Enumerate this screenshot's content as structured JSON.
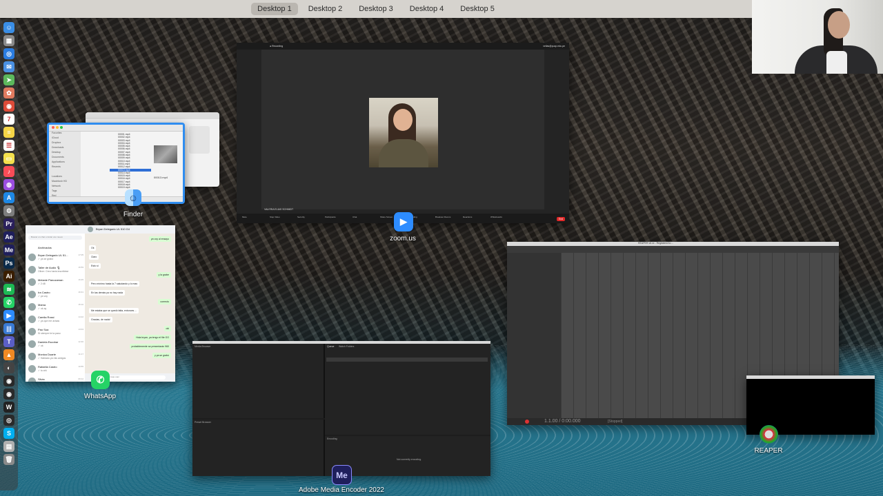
{
  "spaces": [
    "Desktop 1",
    "Desktop 2",
    "Desktop 3",
    "Desktop 4",
    "Desktop 5"
  ],
  "active_space": "Desktop 1",
  "dock_icons": [
    {
      "name": "finder-dock-icon",
      "color": "#3a8ee6",
      "glyph": "☺"
    },
    {
      "name": "launchpad-dock-icon",
      "color": "#8a8a8a",
      "glyph": "▦"
    },
    {
      "name": "safari-dock-icon",
      "color": "#2a7ce0",
      "glyph": "◎"
    },
    {
      "name": "mail-dock-icon",
      "color": "#4a90e2",
      "glyph": "✉"
    },
    {
      "name": "maps-dock-icon",
      "color": "#5cb85c",
      "glyph": "➤"
    },
    {
      "name": "photos-dock-icon",
      "color": "#e07a5f",
      "glyph": "✿"
    },
    {
      "name": "chrome-dock-icon",
      "color": "#dd4b39",
      "glyph": "◉"
    },
    {
      "name": "calendar-dock-icon",
      "color": "#ffffff",
      "glyph": "7"
    },
    {
      "name": "notes-dock-icon",
      "color": "#f5d547",
      "glyph": "≡"
    },
    {
      "name": "reminders-dock-icon",
      "color": "#ffffff",
      "glyph": "☰"
    },
    {
      "name": "stickies-dock-icon",
      "color": "#f4e04d",
      "glyph": "▭"
    },
    {
      "name": "music-dock-icon",
      "color": "#f94c57",
      "glyph": "♪"
    },
    {
      "name": "podcasts-dock-icon",
      "color": "#9b4de0",
      "glyph": "◍"
    },
    {
      "name": "appstore-dock-icon",
      "color": "#1e88e5",
      "glyph": "A"
    },
    {
      "name": "settings-dock-icon",
      "color": "#7d7d7d",
      "glyph": "⚙"
    },
    {
      "name": "premiere-dock-icon",
      "color": "#2a1f5c",
      "glyph": "Pr"
    },
    {
      "name": "after-effects-dock-icon",
      "color": "#1f1f5c",
      "glyph": "Ae"
    },
    {
      "name": "media-encoder-dock-icon",
      "color": "#1f1f5c",
      "glyph": "Me"
    },
    {
      "name": "photoshop-dock-icon",
      "color": "#0a2a4a",
      "glyph": "Ps"
    },
    {
      "name": "illustrator-dock-icon",
      "color": "#3a1e00",
      "glyph": "Ai"
    },
    {
      "name": "spotify-dock-icon",
      "color": "#1db954",
      "glyph": "≋"
    },
    {
      "name": "whatsapp-dock-icon",
      "color": "#25d366",
      "glyph": "✆"
    },
    {
      "name": "zoom-dock-icon",
      "color": "#2d8cff",
      "glyph": "▶"
    },
    {
      "name": "audio-dock-icon",
      "color": "#3a7bd5",
      "glyph": "|||"
    },
    {
      "name": "teams-dock-icon",
      "color": "#5b5fc7",
      "glyph": "T"
    },
    {
      "name": "vlc-dock-icon",
      "color": "#f08a24",
      "glyph": "▲"
    },
    {
      "name": "misc-dock-icon",
      "color": "#444444",
      "glyph": "◐"
    },
    {
      "name": "reaper-dock-icon",
      "color": "#2a2a2a",
      "glyph": "◉"
    },
    {
      "name": "reaper-alt-dock-icon",
      "color": "#2a2a2a",
      "glyph": "◉"
    },
    {
      "name": "wordpress-dock-icon",
      "color": "#222222",
      "glyph": "W"
    },
    {
      "name": "misc2-dock-icon",
      "color": "#2a2a2a",
      "glyph": "◎"
    },
    {
      "name": "skype-dock-icon",
      "color": "#00aff0",
      "glyph": "S"
    },
    {
      "name": "preview-dock-icon",
      "color": "#b0b0b0",
      "glyph": "▤"
    },
    {
      "name": "trash-dock-icon",
      "color": "#8a8a8a",
      "glyph": "🗑"
    }
  ],
  "finder": {
    "app_label": "Finder",
    "sidebar": [
      "Favorites",
      "iCloud",
      "Dropbox",
      "Downloads",
      "Desktop",
      "Documents",
      "Applications",
      "Recents",
      "",
      "Locations",
      "Macintosh HD",
      "Network",
      "Tags",
      "Red",
      "Orange",
      "Yellow",
      "Green",
      "Blue",
      "Purple"
    ],
    "files": [
      "00001.mp4",
      "00002.mp4",
      "00003.mp4",
      "00004.mp4",
      "00005.mp4",
      "00006.mp4",
      "00007.mp4",
      "00008.mp4",
      "00009.mp4",
      "00010.mp4",
      "00011.mp4",
      "00012.mp4",
      "00013.mp4",
      "00014.mp4",
      "00015.mp4",
      "00016.mp4",
      "00017.mp4",
      "00018.mp4",
      "00019.mp4"
    ],
    "selected_file": "00013.mp4",
    "preview_name": "00013.mp4"
  },
  "zoom": {
    "app_label": "zoom.us",
    "participant_name": "VALERIA ELIAS SCHMIDT",
    "toolbar": [
      "Mute",
      "Stop Video",
      "Security",
      "Participants",
      "Chat",
      "Share Screen",
      "Recording",
      "Breakout Rooms",
      "Reactions",
      "Whiteboards"
    ],
    "end_label": "End",
    "recording_label": "Recording",
    "email": "vellas@pucp.edu.pe",
    "end_color": "#e02828"
  },
  "whatsapp": {
    "app_label": "WhatsApp",
    "chat_title": "Bryan Delegado UL 510 G4",
    "archived_label": "Archivados",
    "search_placeholder": "Buscar un chat o iniciar uno nuevo",
    "chats": [
      {
        "name": "Bryan Delegado UL 51...",
        "msg": "✓ ya se grabó",
        "time": "17:05"
      },
      {
        "name": "Taller de Audio 🎙",
        "msg": "Oliver: Creo haría inscribirse",
        "time": "16:59"
      },
      {
        "name": "Melanie Panozaman",
        "msg": "✓ 2:48",
        "time": "16:45"
      },
      {
        "name": "Ira Castro",
        "msg": "✓ ya voy",
        "time": "16:31"
      },
      {
        "name": "Mama",
        "msg": "✓ ok ay",
        "time": "15:10"
      },
      {
        "name": "Camila Rossi",
        "msg": "✓ ya que me avisas",
        "time": "14:22"
      },
      {
        "name": "Pao Sua",
        "msg": "Si siempre te la paso",
        "time": "13:04"
      },
      {
        "name": "Daniela Escobar",
        "msg": "✓ ok",
        "time": "12:40"
      },
      {
        "name": "Monica Duarte",
        "msg": "✓ Hablado ya mis amigos",
        "time": "11:17"
      },
      {
        "name": "Rafaella Castro",
        "msg": "✓ tu ahí",
        "time": "10:55"
      },
      {
        "name": "Silvia",
        "msg": "",
        "time": "09:12"
      }
    ],
    "bubbles": [
      {
        "dir": "out",
        "text": "ya voy al ensayo"
      },
      {
        "dir": "in",
        "text": "Ok"
      },
      {
        "dir": "in",
        "text": "Claro"
      },
      {
        "dir": "in",
        "text": "Esto sí"
      },
      {
        "dir": "out",
        "text": "y la grabe"
      },
      {
        "dir": "in",
        "text": "Pero mínimo hasta la 7 saludando y lo mas"
      },
      {
        "dir": "in",
        "text": "En las demás ya no hay nada"
      },
      {
        "dir": "out",
        "text": "correcto"
      },
      {
        "dir": "in",
        "text": "Me estaba que se quedó falta, entonces ..."
      },
      {
        "dir": "in",
        "text": "Gracias, de nada!"
      },
      {
        "dir": "out",
        "text": "oki"
      },
      {
        "dir": "out",
        "text": "Hola bryan, ya tengo el file GO"
      },
      {
        "dir": "out",
        "text": "probablemente se presentarán 960"
      },
      {
        "dir": "out",
        "text": "y ya se grabó"
      }
    ],
    "input_placeholder": "Escribe un mensaje aquí"
  },
  "reaper": {
    "app_label": "REAPER",
    "title": "REAPER v6.xx - Registered to ...",
    "time": "1.1.00 / 0:00.000",
    "status": "[Stopped]"
  },
  "encoder": {
    "app_label": "Adobe Media Encoder 2022",
    "panels": [
      "Media Browser",
      "Queue",
      "Watch Folders",
      "Preset Browser",
      "Encoding"
    ],
    "status": "Not currently encoding."
  }
}
